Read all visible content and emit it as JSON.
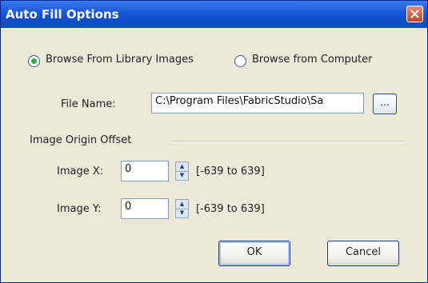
{
  "window": {
    "title": "Auto Fill Options"
  },
  "source": {
    "option_library": "Browse From Library Images",
    "option_computer": "Browse from Computer"
  },
  "file": {
    "label": "File Name:",
    "value": "C:\\Program Files\\FabricStudio\\Sa",
    "browse_label": "..."
  },
  "offset": {
    "group_label": "Image Origin Offset",
    "x_label": "Image X:",
    "x_value": "0",
    "x_range": "[-639 to 639]",
    "y_label": "Image Y:",
    "y_value": "0",
    "y_range": "[-639 to 639]"
  },
  "buttons": {
    "ok": "OK",
    "cancel": "Cancel"
  }
}
